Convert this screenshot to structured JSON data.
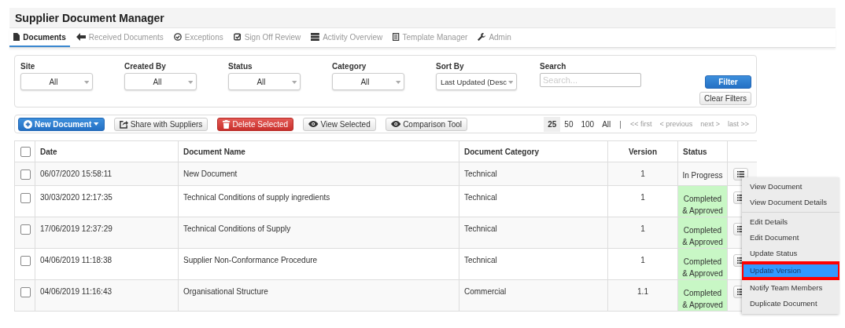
{
  "window": {
    "title": "Supplier Document Manager"
  },
  "tabs": [
    {
      "label": "Documents",
      "selected": true
    },
    {
      "label": "Received Documents",
      "selected": false
    },
    {
      "label": "Exceptions",
      "selected": false
    },
    {
      "label": "Sign Off Review",
      "selected": false
    },
    {
      "label": "Activity Overview",
      "selected": false
    },
    {
      "label": "Template Manager",
      "selected": false
    },
    {
      "label": "Admin",
      "selected": false
    }
  ],
  "filters": [
    {
      "label": "Site",
      "kind": "select",
      "value": "All"
    },
    {
      "label": "Created By",
      "kind": "select",
      "value": "All"
    },
    {
      "label": "Status",
      "kind": "select",
      "value": "All"
    },
    {
      "label": "Category",
      "kind": "select",
      "value": "All"
    },
    {
      "label": "Sort By",
      "kind": "select",
      "value": "Last Updated (Desc"
    },
    {
      "label": "Search",
      "kind": "search",
      "placeholder": "Search..."
    }
  ],
  "filter_buttons": [
    {
      "label": "Filter",
      "kind": "primary"
    },
    {
      "label": "Clear Filters",
      "kind": "default"
    }
  ],
  "toolbar": {
    "buttons": [
      {
        "label": "New Document",
        "kind": "primary"
      },
      {
        "label": "Share with Suppliers",
        "kind": "default"
      },
      {
        "label": "Delete Selected",
        "kind": "danger"
      },
      {
        "label": "View Selected",
        "kind": "default"
      },
      {
        "label": "Comparison Tool",
        "kind": "default"
      }
    ],
    "page_sizes": [
      {
        "label": "25",
        "selected": true
      },
      {
        "label": "50",
        "selected": false
      },
      {
        "label": "100",
        "selected": false
      },
      {
        "label": "All",
        "selected": false
      }
    ],
    "separator": "|",
    "pager": [
      {
        "label": "<< first",
        "disabled": true
      },
      {
        "label": "< previous",
        "disabled": true
      },
      {
        "label": "next >",
        "disabled": true
      },
      {
        "label": "last >>",
        "disabled": true
      }
    ]
  },
  "table": {
    "select_all_checked": false,
    "columns": [
      "Date",
      "Document Name",
      "Document Category",
      "Version",
      "Status"
    ],
    "rows": [
      {
        "checked": false,
        "date": "06/07/2020 15:58:11",
        "name": "New Document",
        "category": "Technical",
        "version": "1",
        "status": "In Progress"
      },
      {
        "checked": false,
        "date": "30/03/2020 12:17:35",
        "name": "Technical Conditions of supply ingredients",
        "category": "Technical",
        "version": "1",
        "status": "Completed & Approved",
        "color": "#c8f7c5"
      },
      {
        "checked": false,
        "date": "17/06/2019 12:37:29",
        "name": "Technical Conditions of Supply",
        "category": "Technical",
        "version": "1",
        "status": "Completed & Approved",
        "color": "#c8f7c5"
      },
      {
        "checked": false,
        "date": "04/06/2019 11:18:38",
        "name": "Supplier Non-Conformance Procedure",
        "category": "Technical",
        "version": "1",
        "status": "Completed & Approved",
        "color": "#c8f7c5"
      },
      {
        "checked": false,
        "date": "04/06/2019 11:16:43",
        "name": "Organisational Structure",
        "category": "Commercial",
        "version": "1.1",
        "status": "Completed & Approved",
        "color": "#c8f7c5"
      }
    ]
  },
  "context_menu": {
    "groups": [
      {
        "items": [
          {
            "label": "View Document",
            "selected": false
          },
          {
            "label": "View Document Details",
            "selected": false
          }
        ]
      },
      {
        "items": [
          {
            "label": "Edit Details",
            "selected": false
          },
          {
            "label": "Edit Document",
            "selected": false
          },
          {
            "label": "Update Status",
            "selected": false
          },
          {
            "label": "Update Version",
            "selected": true
          },
          {
            "label": "Notify Team Members",
            "selected": false
          },
          {
            "label": "Duplicate Document",
            "selected": false
          }
        ]
      }
    ]
  }
}
